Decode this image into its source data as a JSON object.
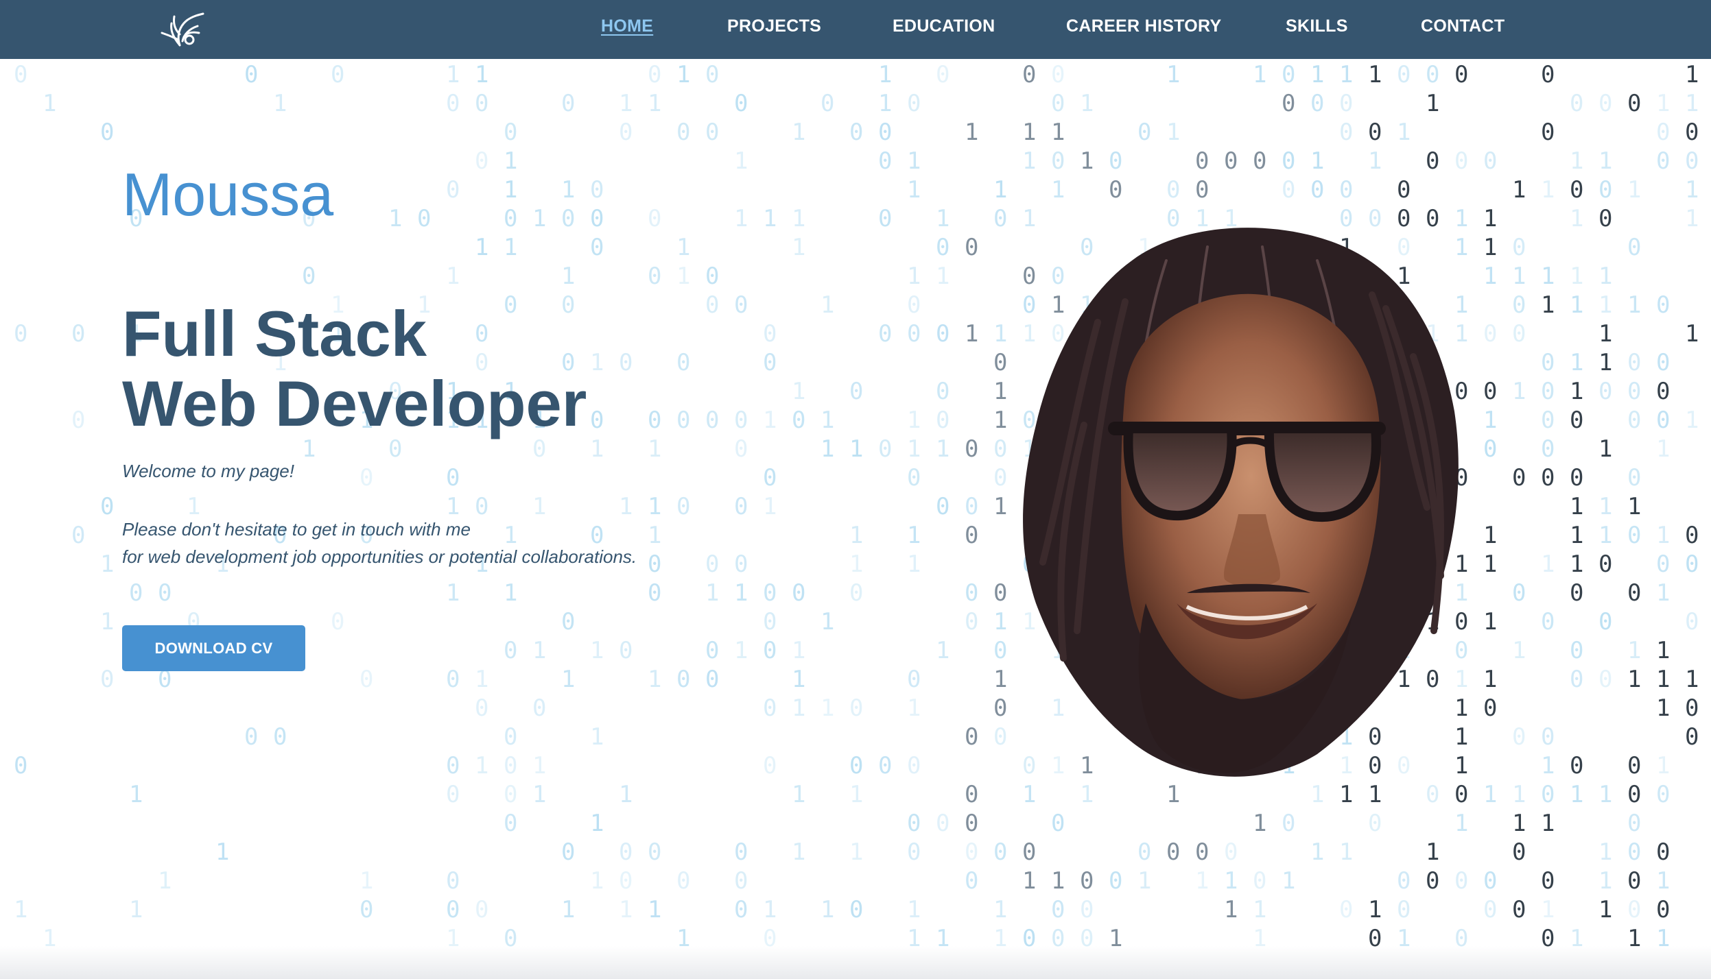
{
  "nav": {
    "logo_icon": "stylized-bird-feather-logo",
    "links": [
      {
        "label": "HOME",
        "active": true
      },
      {
        "label": "PROJECTS",
        "active": false
      },
      {
        "label": "EDUCATION",
        "active": false
      },
      {
        "label": "CAREER HISTORY",
        "active": false
      },
      {
        "label": "SKILLS",
        "active": false
      },
      {
        "label": "CONTACT",
        "active": false
      }
    ]
  },
  "hero": {
    "name": "Moussa",
    "title_line1": "Full Stack",
    "title_line2": "Web Developer",
    "welcome": "Welcome to my page!",
    "contact_line1": "Please don't hesitate to get in touch with me",
    "contact_line2": "for web development job opportunities or potential collaborations.",
    "download_button": "DOWNLOAD CV"
  },
  "colors": {
    "nav_bg": "#36556f",
    "accent": "#4791d1",
    "heading": "#36556f",
    "active_link": "#8ec7f0"
  }
}
